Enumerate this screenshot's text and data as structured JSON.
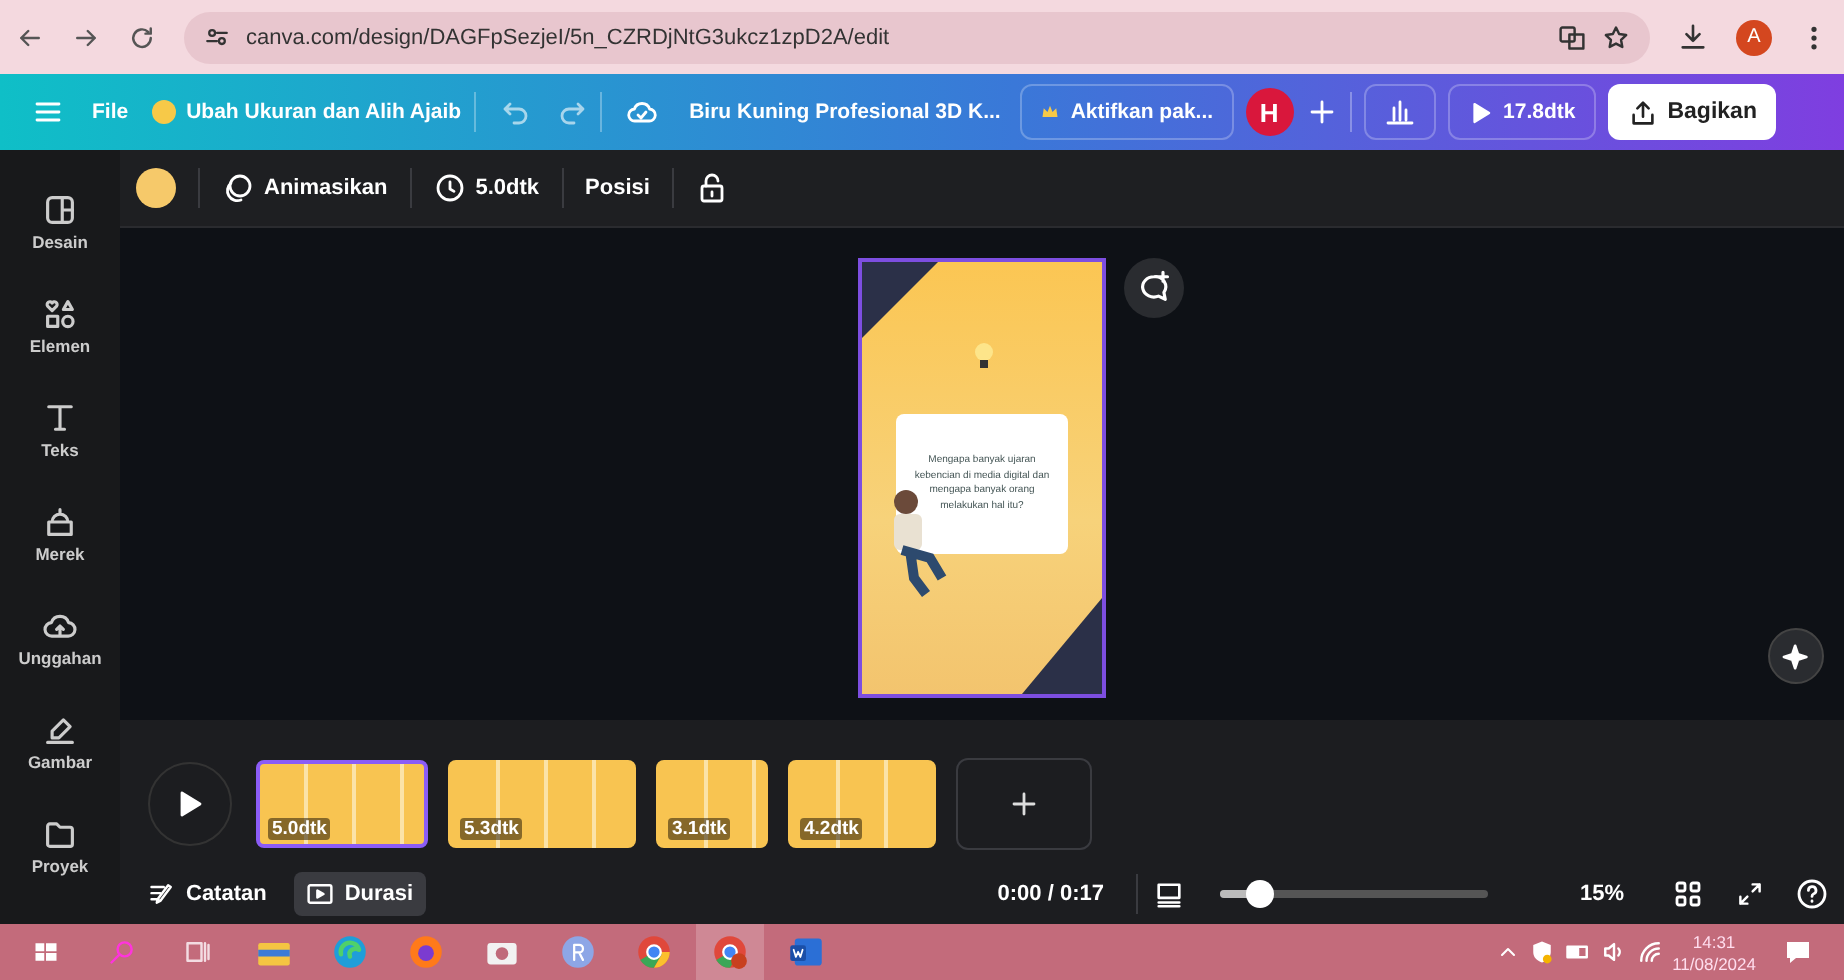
{
  "browser": {
    "url": "canva.com/design/DAGFpSezjeI/5n_CZRDjNtG3ukcz1zpD2A/edit",
    "avatar": "A"
  },
  "topbar": {
    "file": "File",
    "resize": "Ubah Ukuran dan Alih Ajaib",
    "title": "Biru Kuning Profesional 3D K...",
    "upgrade": "Aktifkan pak...",
    "avatar": "H",
    "play": "17.8dtk",
    "share": "Bagikan"
  },
  "sidebar": [
    {
      "kind": "layout",
      "label": "Desain"
    },
    {
      "kind": "shapes",
      "label": "Elemen"
    },
    {
      "kind": "text",
      "label": "Teks"
    },
    {
      "kind": "brand",
      "label": "Merek"
    },
    {
      "kind": "upload",
      "label": "Unggahan"
    },
    {
      "kind": "draw",
      "label": "Gambar"
    },
    {
      "kind": "folder",
      "label": "Proyek"
    }
  ],
  "toolbar": {
    "animate": "Animasikan",
    "duration": "5.0dtk",
    "position": "Posisi"
  },
  "design": {
    "question": "Mengapa banyak ujaran kebencian di media digital dan mengapa banyak orang melakukan hal itu?"
  },
  "timeline": {
    "clips": [
      {
        "duration": "5.0dtk",
        "selected": true
      },
      {
        "duration": "5.3dtk",
        "selected": false
      },
      {
        "duration": "3.1dtk",
        "selected": false
      },
      {
        "duration": "4.2dtk",
        "selected": false
      }
    ]
  },
  "bottom": {
    "notes": "Catatan",
    "duration_view": {
      "label": "Durasi",
      "selected": true
    },
    "time": "0:00 / 0:17",
    "zoom": {
      "level": 0.15
    },
    "zoom_reading": "15%"
  },
  "taskbar": {
    "apps": [
      {
        "kind": "explorer",
        "selected": false
      },
      {
        "kind": "edge",
        "selected": false
      },
      {
        "kind": "firefox",
        "selected": false
      },
      {
        "kind": "camera",
        "selected": false
      },
      {
        "kind": "r",
        "selected": false
      },
      {
        "kind": "chrome",
        "selected": false
      },
      {
        "kind": "chrome-profile",
        "selected": true
      },
      {
        "kind": "word",
        "selected": false
      }
    ],
    "time": "14:31",
    "date": "11/08/2024"
  }
}
